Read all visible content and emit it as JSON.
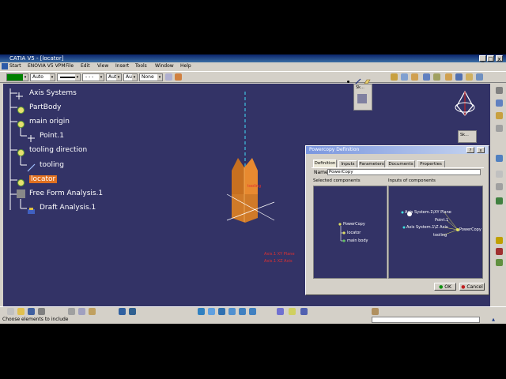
{
  "window": {
    "title": "CATIA V5 - [locator]",
    "minimize": "_",
    "maximize": "□",
    "close": "x"
  },
  "menu": [
    "Start",
    "ENOVIA V5 VPM",
    "File",
    "Edit",
    "View",
    "Insert",
    "Tools",
    "Window",
    "Help"
  ],
  "toolbar": {
    "line_type": "Auto",
    "layer": "Aut",
    "weight": "Aut",
    "filter": "None",
    "color_hex": "#008000"
  },
  "tree": [
    {
      "label": "Axis Systems",
      "icon": "axis-systems-icon"
    },
    {
      "label": "PartBody",
      "icon": "gear-icon"
    },
    {
      "label": "main origin",
      "icon": "gear-icon"
    },
    {
      "label": "Point.1",
      "icon": "point-icon"
    },
    {
      "label": "tooling direction",
      "icon": "gear-icon"
    },
    {
      "label": "tooling",
      "icon": "line-icon"
    },
    {
      "label": "locator",
      "icon": "gear-icon"
    },
    {
      "label": "Free Form Analysis.1",
      "icon": "analysis-icon"
    },
    {
      "label": "Draft Analysis.1",
      "icon": "draft-analysis-icon"
    }
  ],
  "viewport_labels": {
    "origin": "tooling",
    "plane1": "Axis.1 XY Plane",
    "plane2": "Axis.1 XZ Axis"
  },
  "sketch_box": {
    "label": "Sk..."
  },
  "sketch_box_2": {
    "label": "Sk..."
  },
  "dialog": {
    "title": "Powercopy Definition",
    "help": "?",
    "close": "x",
    "tabs": [
      "Definition",
      "Inputs",
      "Parameters",
      "Documents",
      "Properties"
    ],
    "name_label": "Name:",
    "name_value": "PowerCopy",
    "selected_label": "Selected components",
    "inputs_label": "Inputs of components",
    "selected_items": [
      "PowerCopy",
      "locator",
      "main body"
    ],
    "inputs_items": [
      "Axis System.1\\XY Plane",
      "Point.1",
      "Axis System.1\\Z Axis",
      "tooling",
      "PowerCopy"
    ],
    "ok": "OK",
    "cancel": "Cancel"
  },
  "status": {
    "text": "Choose elements to include"
  }
}
